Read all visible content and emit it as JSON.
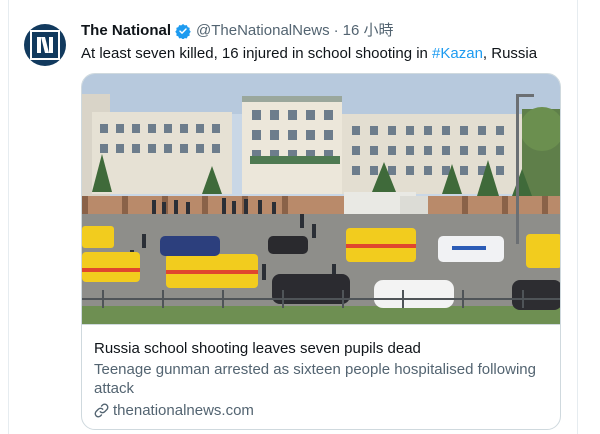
{
  "tweet": {
    "author_name": "The National",
    "handle": "@TheNationalNews",
    "separator": "·",
    "time": "16 小時",
    "text_before": "At least seven killed, 16 injured in school shooting in ",
    "hashtag": "#Kazan",
    "text_after": ", Russia"
  },
  "card": {
    "image_icon": "news-photo",
    "title": "Russia school shooting leaves seven pupils dead",
    "description": "Teenage gunman arrested as sixteen people hospitalised following attack",
    "domain": "thenationalnews.com",
    "link_icon": "link-icon"
  },
  "colors": {
    "accent": "#1d9bf0",
    "avatar_bg": "#123a5e",
    "secondary_text": "#536471",
    "border": "#cfd9de"
  }
}
